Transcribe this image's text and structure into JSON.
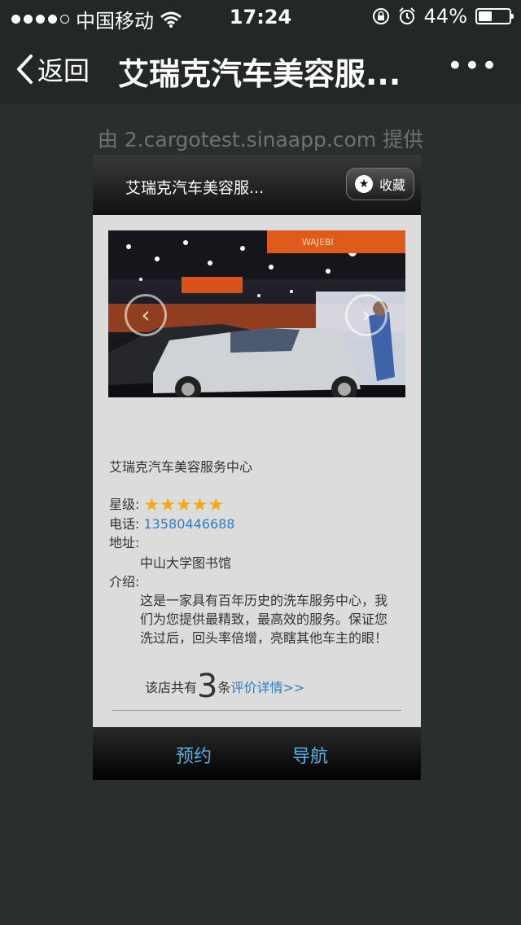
{
  "status": {
    "carrier": "中国移动",
    "time": "17:24",
    "battery": "44%",
    "battery_level": 0.44
  },
  "nav": {
    "back_label": "返回",
    "title": "艾瑞克汽车美容服...",
    "more": "•••"
  },
  "provider_text": "由 2.cargotest.sinaapp.com 提供",
  "card": {
    "title": "艾瑞克汽车美容服...",
    "favorite_label": "收藏",
    "shop_name": "艾瑞克汽车美容服务中心",
    "rating_label": "星级:",
    "stars": "★★★★★",
    "phone_label": "电话:",
    "phone": "13580446688",
    "address_label": "地址:",
    "address": "中山大学图书馆",
    "intro_label": "介绍:",
    "intro": "这是一家具有百年历史的洗车服务中心，我们为您提供最精致，最高效的服务。保证您洗过后，回头率倍增，亮瞎其他车主的眼！",
    "review_prefix": "该店共有",
    "review_count": "3",
    "review_suffix": "条",
    "review_link": "评价详情>>",
    "book_button": "预约",
    "navigate_button": "导航"
  },
  "sign_text": "WAJEBI"
}
